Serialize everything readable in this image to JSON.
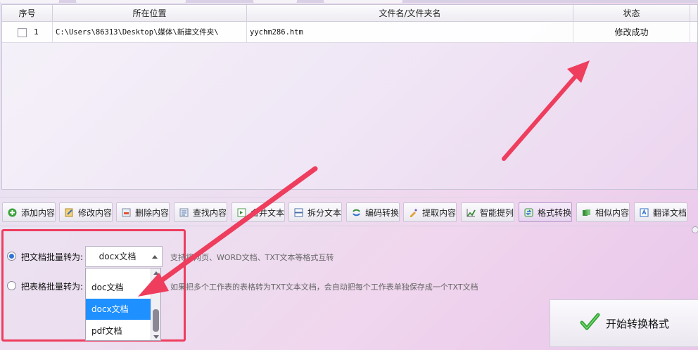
{
  "table": {
    "headers": [
      "序号",
      "所在位置",
      "文件名/文件夹名",
      "状态"
    ],
    "rows": [
      {
        "index": "1",
        "location": "C:\\Users\\86313\\Desktop\\媒体\\新建文件夹\\",
        "filename": "yychm286.htm",
        "status": "修改成功"
      }
    ]
  },
  "toolbar": {
    "buttons": [
      {
        "label": "添加内容",
        "icon": "add-icon"
      },
      {
        "label": "修改内容",
        "icon": "edit-icon"
      },
      {
        "label": "删除内容",
        "icon": "delete-icon"
      },
      {
        "label": "查找内容",
        "icon": "find-icon"
      },
      {
        "label": "合并文本",
        "icon": "merge-icon"
      },
      {
        "label": "拆分文本",
        "icon": "split-icon"
      },
      {
        "label": "编码转换",
        "icon": "encode-icon"
      },
      {
        "label": "提取内容",
        "icon": "extract-icon"
      },
      {
        "label": "智能提列",
        "icon": "column-icon"
      },
      {
        "label": "格式转换",
        "icon": "convert-icon",
        "active": true
      },
      {
        "label": "相似内容",
        "icon": "similar-icon"
      },
      {
        "label": "翻译文档",
        "icon": "translate-icon"
      }
    ]
  },
  "options": {
    "doc_label": "把文档批量转为:",
    "sheet_label": "把表格批量转为:",
    "doc_selected": true,
    "select_value": "docx文档",
    "dropdown_options": [
      "doc文档",
      "docx文档",
      "pdf文档"
    ],
    "dropdown_selected": "docx文档",
    "doc_desc": "支持将网页、WORD文档、TXT文本等格式互转",
    "sheet_desc": "如果把多个工作表的表格转为TXT文本文档，会自动把每个工作表单独保存成一个TXT文档"
  },
  "start_button": {
    "label": "开始转换格式"
  },
  "colors": {
    "annotation": "#ee3d5d",
    "selection": "#1e90ff",
    "radio_checked": "#2e74d6",
    "check_green": "#2ea52e"
  }
}
